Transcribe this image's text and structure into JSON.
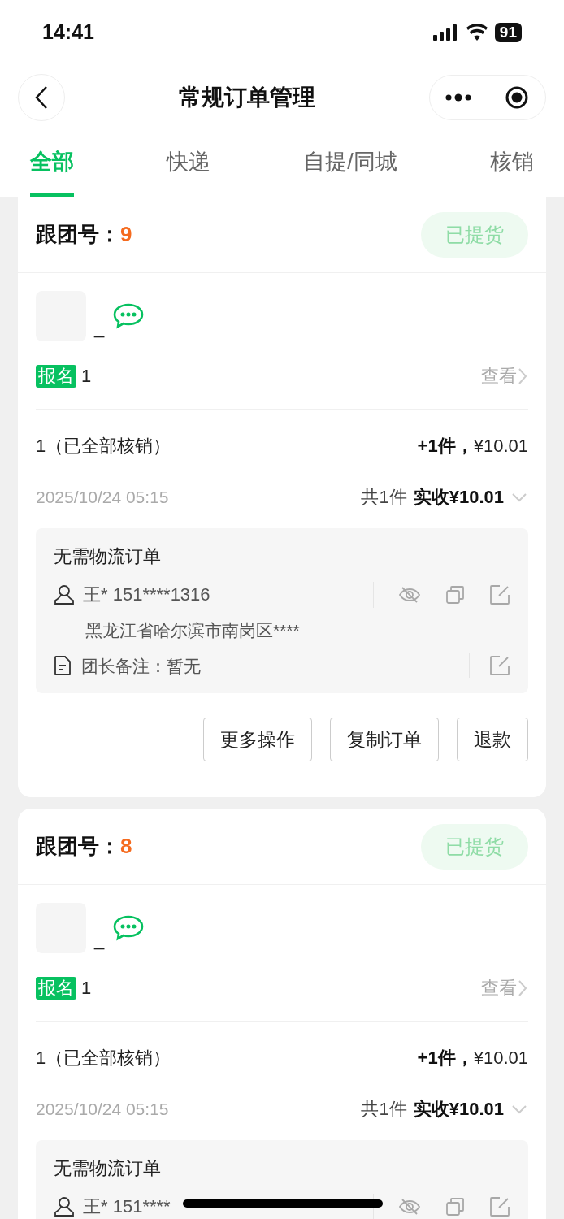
{
  "status_bar": {
    "time": "14:41",
    "battery": "91"
  },
  "nav": {
    "title": "常规订单管理"
  },
  "tabs": [
    {
      "label": "全部",
      "selected": true
    },
    {
      "label": "快递",
      "selected": false
    },
    {
      "label": "自提/同城",
      "selected": false
    },
    {
      "label": "核销",
      "selected": false
    }
  ],
  "orders": [
    {
      "group_label": "跟团号：",
      "group_no": "9",
      "status": "已提货",
      "name": "_",
      "tag": "报名",
      "tag_value": "1",
      "view": "查看",
      "item": "1（已全部核销）",
      "qty": "+1件，",
      "price": "¥10.01",
      "time": "2025/10/24 05:15",
      "total": "共1件",
      "received": "实收¥10.01",
      "delivery": "无需物流订单",
      "contact": "王* 151****1316",
      "address": "黑龙江省哈尔滨市南岗区****",
      "note": "团长备注：暂无",
      "actions": [
        "更多操作",
        "复制订单",
        "退款"
      ]
    },
    {
      "group_label": "跟团号：",
      "group_no": "8",
      "status": "已提货",
      "name": "_",
      "tag": "报名",
      "tag_value": "1",
      "view": "查看",
      "item": "1（已全部核销）",
      "qty": "+1件，",
      "price": "¥10.01",
      "time": "2025/10/24 05:15",
      "total": "共1件",
      "received": "实收¥10.01",
      "delivery": "无需物流订单",
      "contact": "王* 151****"
    }
  ]
}
